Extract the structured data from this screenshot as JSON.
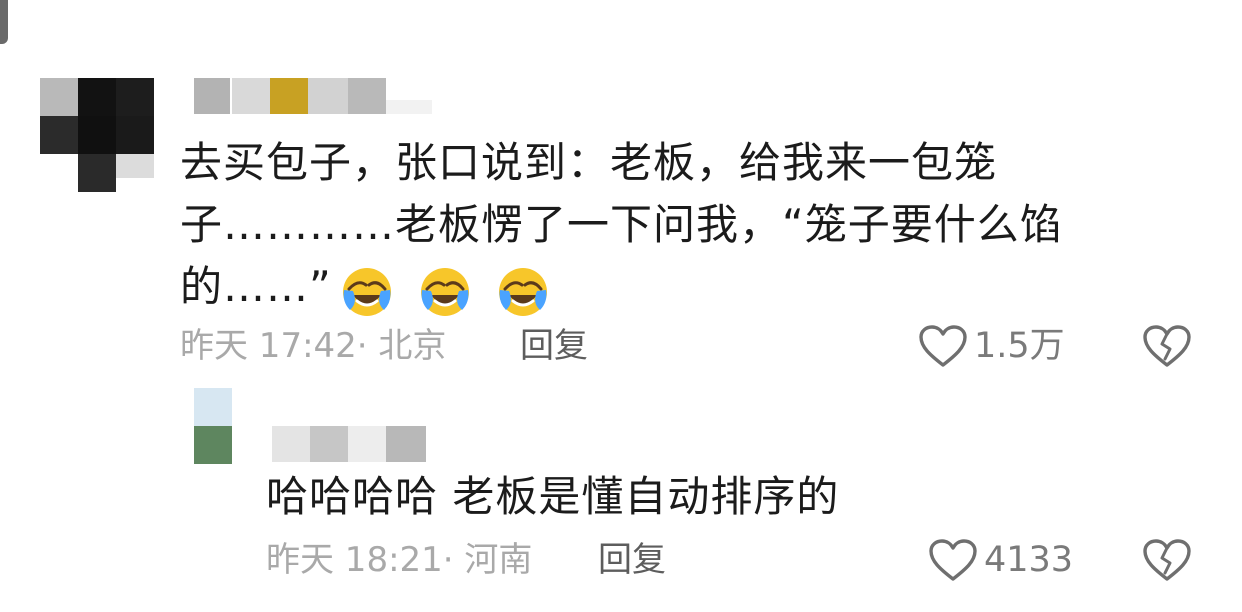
{
  "comments": [
    {
      "text_lines": [
        "去买包子，张口说到：老板，给我来一包笼",
        "子…………老板愣了一下问我，“笼子要什么馅",
        "的……”"
      ],
      "emoji": [
        "face-with-tears-of-joy-icon",
        "face-with-tears-of-joy-icon",
        "face-with-tears-of-joy-icon"
      ],
      "meta": "昨天 17:42· 北京",
      "reply_label": "回复",
      "like_count": "1.5万"
    },
    {
      "text": "哈哈哈哈  老板是懂自动排序的",
      "meta": "昨天 18:21· 河南",
      "reply_label": "回复",
      "like_count": "4133"
    }
  ],
  "colors": {
    "text": "#1b1b1b",
    "meta": "#a9a9a9",
    "action": "#5d5d5d",
    "icon": "#6f6f6f"
  }
}
